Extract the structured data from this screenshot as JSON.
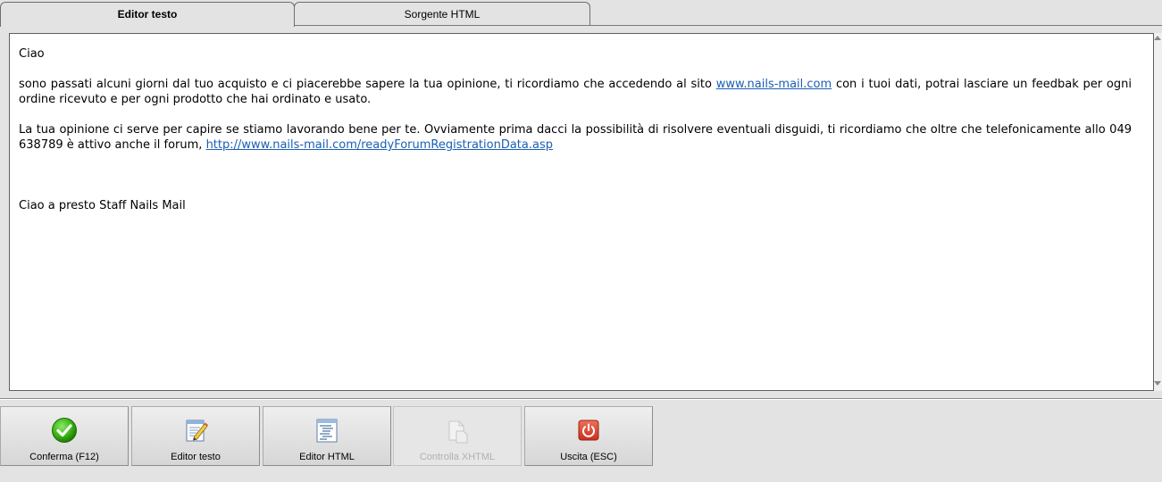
{
  "tabs": [
    {
      "label": "Editor testo",
      "active": true
    },
    {
      "label": "Sorgente HTML",
      "active": false
    }
  ],
  "editor": {
    "greeting": "Ciao",
    "para1_before": "sono passati alcuni giorni dal tuo acquisto e ci piacerebbe sapere la tua opinione, ti ricordiamo che accedendo al sito ",
    "para1_link": "www.nails-mail.com",
    "para1_after": " con i tuoi dati, potrai lasciare un feedbak per ogni ordine ricevuto e per ogni prodotto che hai ordinato e usato.",
    "para2_before": "La tua opinione ci serve per capire se stiamo lavorando bene per te. Ovviamente prima dacci la possibilità di risolvere eventuali disguidi, ti ricordiamo che oltre che telefonicamente allo 049 638789 è attivo anche  il forum, ",
    "para2_link": "http://www.nails-mail.com/readyForumRegistrationData.asp",
    "closing": "Ciao a presto Staff Nails Mail"
  },
  "toolbar": {
    "buttons": [
      {
        "label": "Conferma (F12)",
        "icon": "checkmark-icon",
        "enabled": true
      },
      {
        "label": "Editor testo",
        "icon": "edit-document-icon",
        "enabled": true
      },
      {
        "label": "Editor HTML",
        "icon": "html-document-icon",
        "enabled": true
      },
      {
        "label": "Controlla XHTML",
        "icon": "check-xhtml-icon",
        "enabled": false
      },
      {
        "label": "Uscita (ESC)",
        "icon": "power-exit-icon",
        "enabled": true
      }
    ]
  },
  "colors": {
    "link": "#1a5fb4",
    "confirm_green": "#3cb815",
    "exit_red": "#e3412c"
  }
}
